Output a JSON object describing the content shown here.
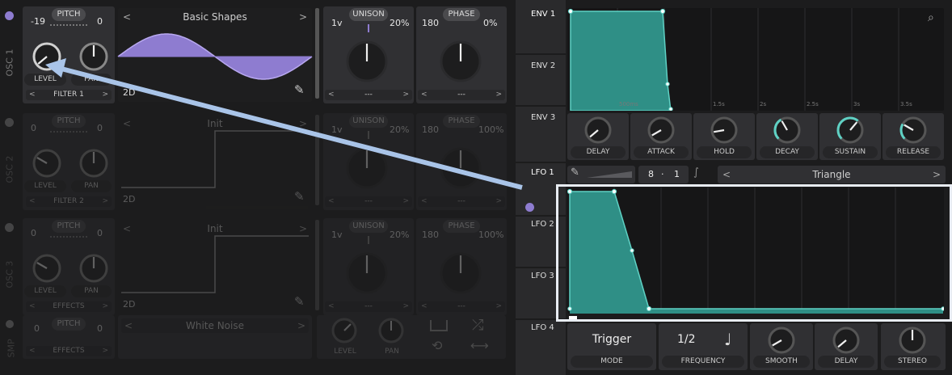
{
  "colors": {
    "accent": "#5fd1c4",
    "osc_purple": "#8e7cd0",
    "env_fill": "#2f8f86",
    "arrow": "#a9c4e8"
  },
  "osc": [
    {
      "side": "OSC 1",
      "pitch_label": "PITCH",
      "pitch_left": "-19",
      "pitch_right": "0",
      "wave": "Basic Shapes",
      "wave_mode": "2D",
      "level": "LEVEL",
      "pan": "PAN",
      "dest": "FILTER 1",
      "unison_label": "UNISON",
      "unison_voices": "1v",
      "unison_amt": "20%",
      "phase_label": "PHASE",
      "phase_val": "180",
      "phase_amt": "0%",
      "sel1": "---",
      "sel2": "---"
    },
    {
      "side": "OSC 2",
      "pitch_label": "PITCH",
      "pitch_left": "0",
      "pitch_right": "0",
      "wave": "Init",
      "wave_mode": "2D",
      "level": "LEVEL",
      "pan": "PAN",
      "dest": "FILTER 2",
      "unison_label": "UNISON",
      "unison_voices": "1v",
      "unison_amt": "20%",
      "phase_label": "PHASE",
      "phase_val": "180",
      "phase_amt": "100%",
      "sel1": "---",
      "sel2": "---"
    },
    {
      "side": "OSC 3",
      "pitch_label": "PITCH",
      "pitch_left": "0",
      "pitch_right": "0",
      "wave": "Init",
      "wave_mode": "2D",
      "level": "LEVEL",
      "pan": "PAN",
      "dest": "EFFECTS",
      "unison_label": "UNISON",
      "unison_voices": "1v",
      "unison_amt": "20%",
      "phase_label": "PHASE",
      "phase_val": "180",
      "phase_amt": "100%",
      "sel1": "---",
      "sel2": "---"
    }
  ],
  "smp": {
    "side": "SMP",
    "pitch_label": "PITCH",
    "pitch_left": "0",
    "pitch_right": "0",
    "sample": "White Noise",
    "dest": "EFFECTS",
    "level": "LEVEL",
    "pan": "PAN"
  },
  "env": {
    "tabs": [
      "ENV 1",
      "ENV 2",
      "ENV 3"
    ],
    "time_labels": [
      "500ms",
      "1.5s",
      "2s",
      "2.5s",
      "3s",
      "3.5s"
    ],
    "knobs": [
      "DELAY",
      "ATTACK",
      "HOLD",
      "DECAY",
      "SUSTAIN",
      "RELEASE"
    ]
  },
  "lfo": {
    "tabs": [
      "LFO 1",
      "LFO 2",
      "LFO 3",
      "LFO 4"
    ],
    "sync_num": "8",
    "sync_dot": "·",
    "sync_den": "1",
    "shape": "Triangle",
    "mode_value": "Trigger",
    "mode_label": "MODE",
    "freq_value": "1/2",
    "freq_label": "FREQUENCY",
    "knobs": [
      "SMOOTH",
      "DELAY",
      "STEREO"
    ]
  }
}
